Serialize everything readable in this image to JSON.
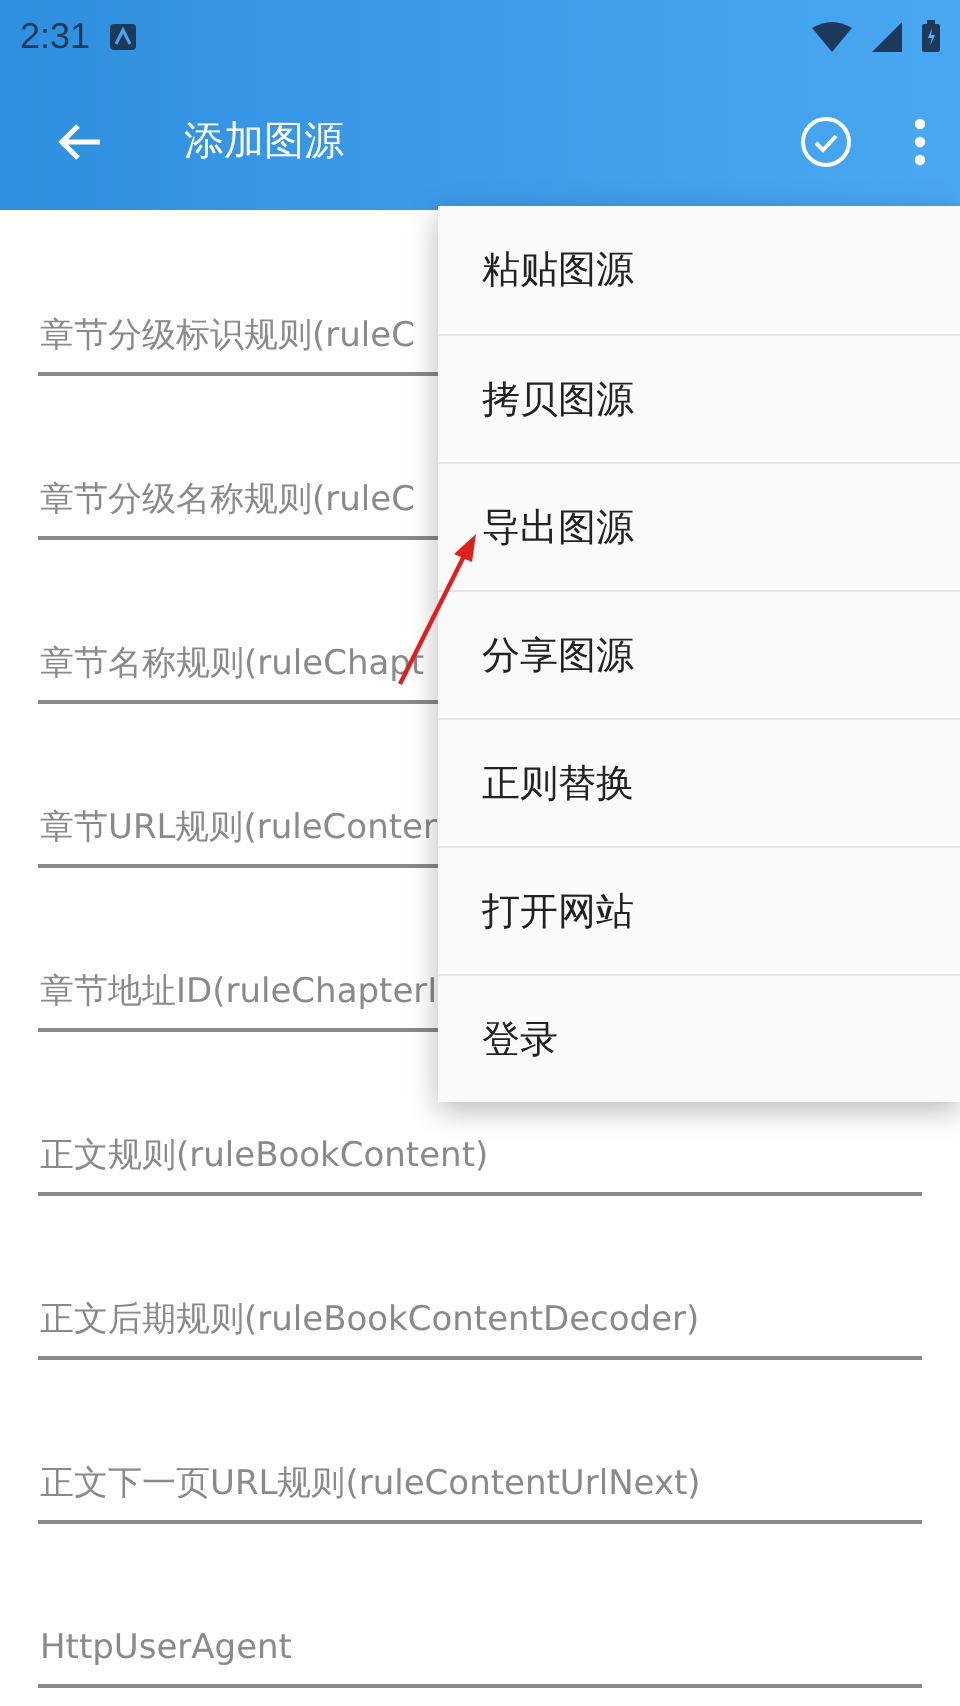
{
  "status_bar": {
    "time": "2:31"
  },
  "app_bar": {
    "title": "添加图源"
  },
  "fields": [
    {
      "placeholder": "章节分级标识规则(ruleC"
    },
    {
      "placeholder": "章节分级名称规则(ruleC"
    },
    {
      "placeholder": "章节名称规则(ruleChapt"
    },
    {
      "placeholder": "章节URL规则(ruleConter"
    },
    {
      "placeholder": "章节地址ID(ruleChapterI"
    },
    {
      "placeholder": "正文规则(ruleBookContent)"
    },
    {
      "placeholder": "正文后期规则(ruleBookContentDecoder)"
    },
    {
      "placeholder": "正文下一页URL规则(ruleContentUrlNext)"
    },
    {
      "placeholder": "HttpUserAgent"
    }
  ],
  "menu": {
    "items": [
      {
        "label": "粘贴图源"
      },
      {
        "label": "拷贝图源"
      },
      {
        "label": "导出图源"
      },
      {
        "label": "分享图源"
      },
      {
        "label": "正则替换"
      },
      {
        "label": "打开网站"
      },
      {
        "label": "登录"
      }
    ]
  }
}
